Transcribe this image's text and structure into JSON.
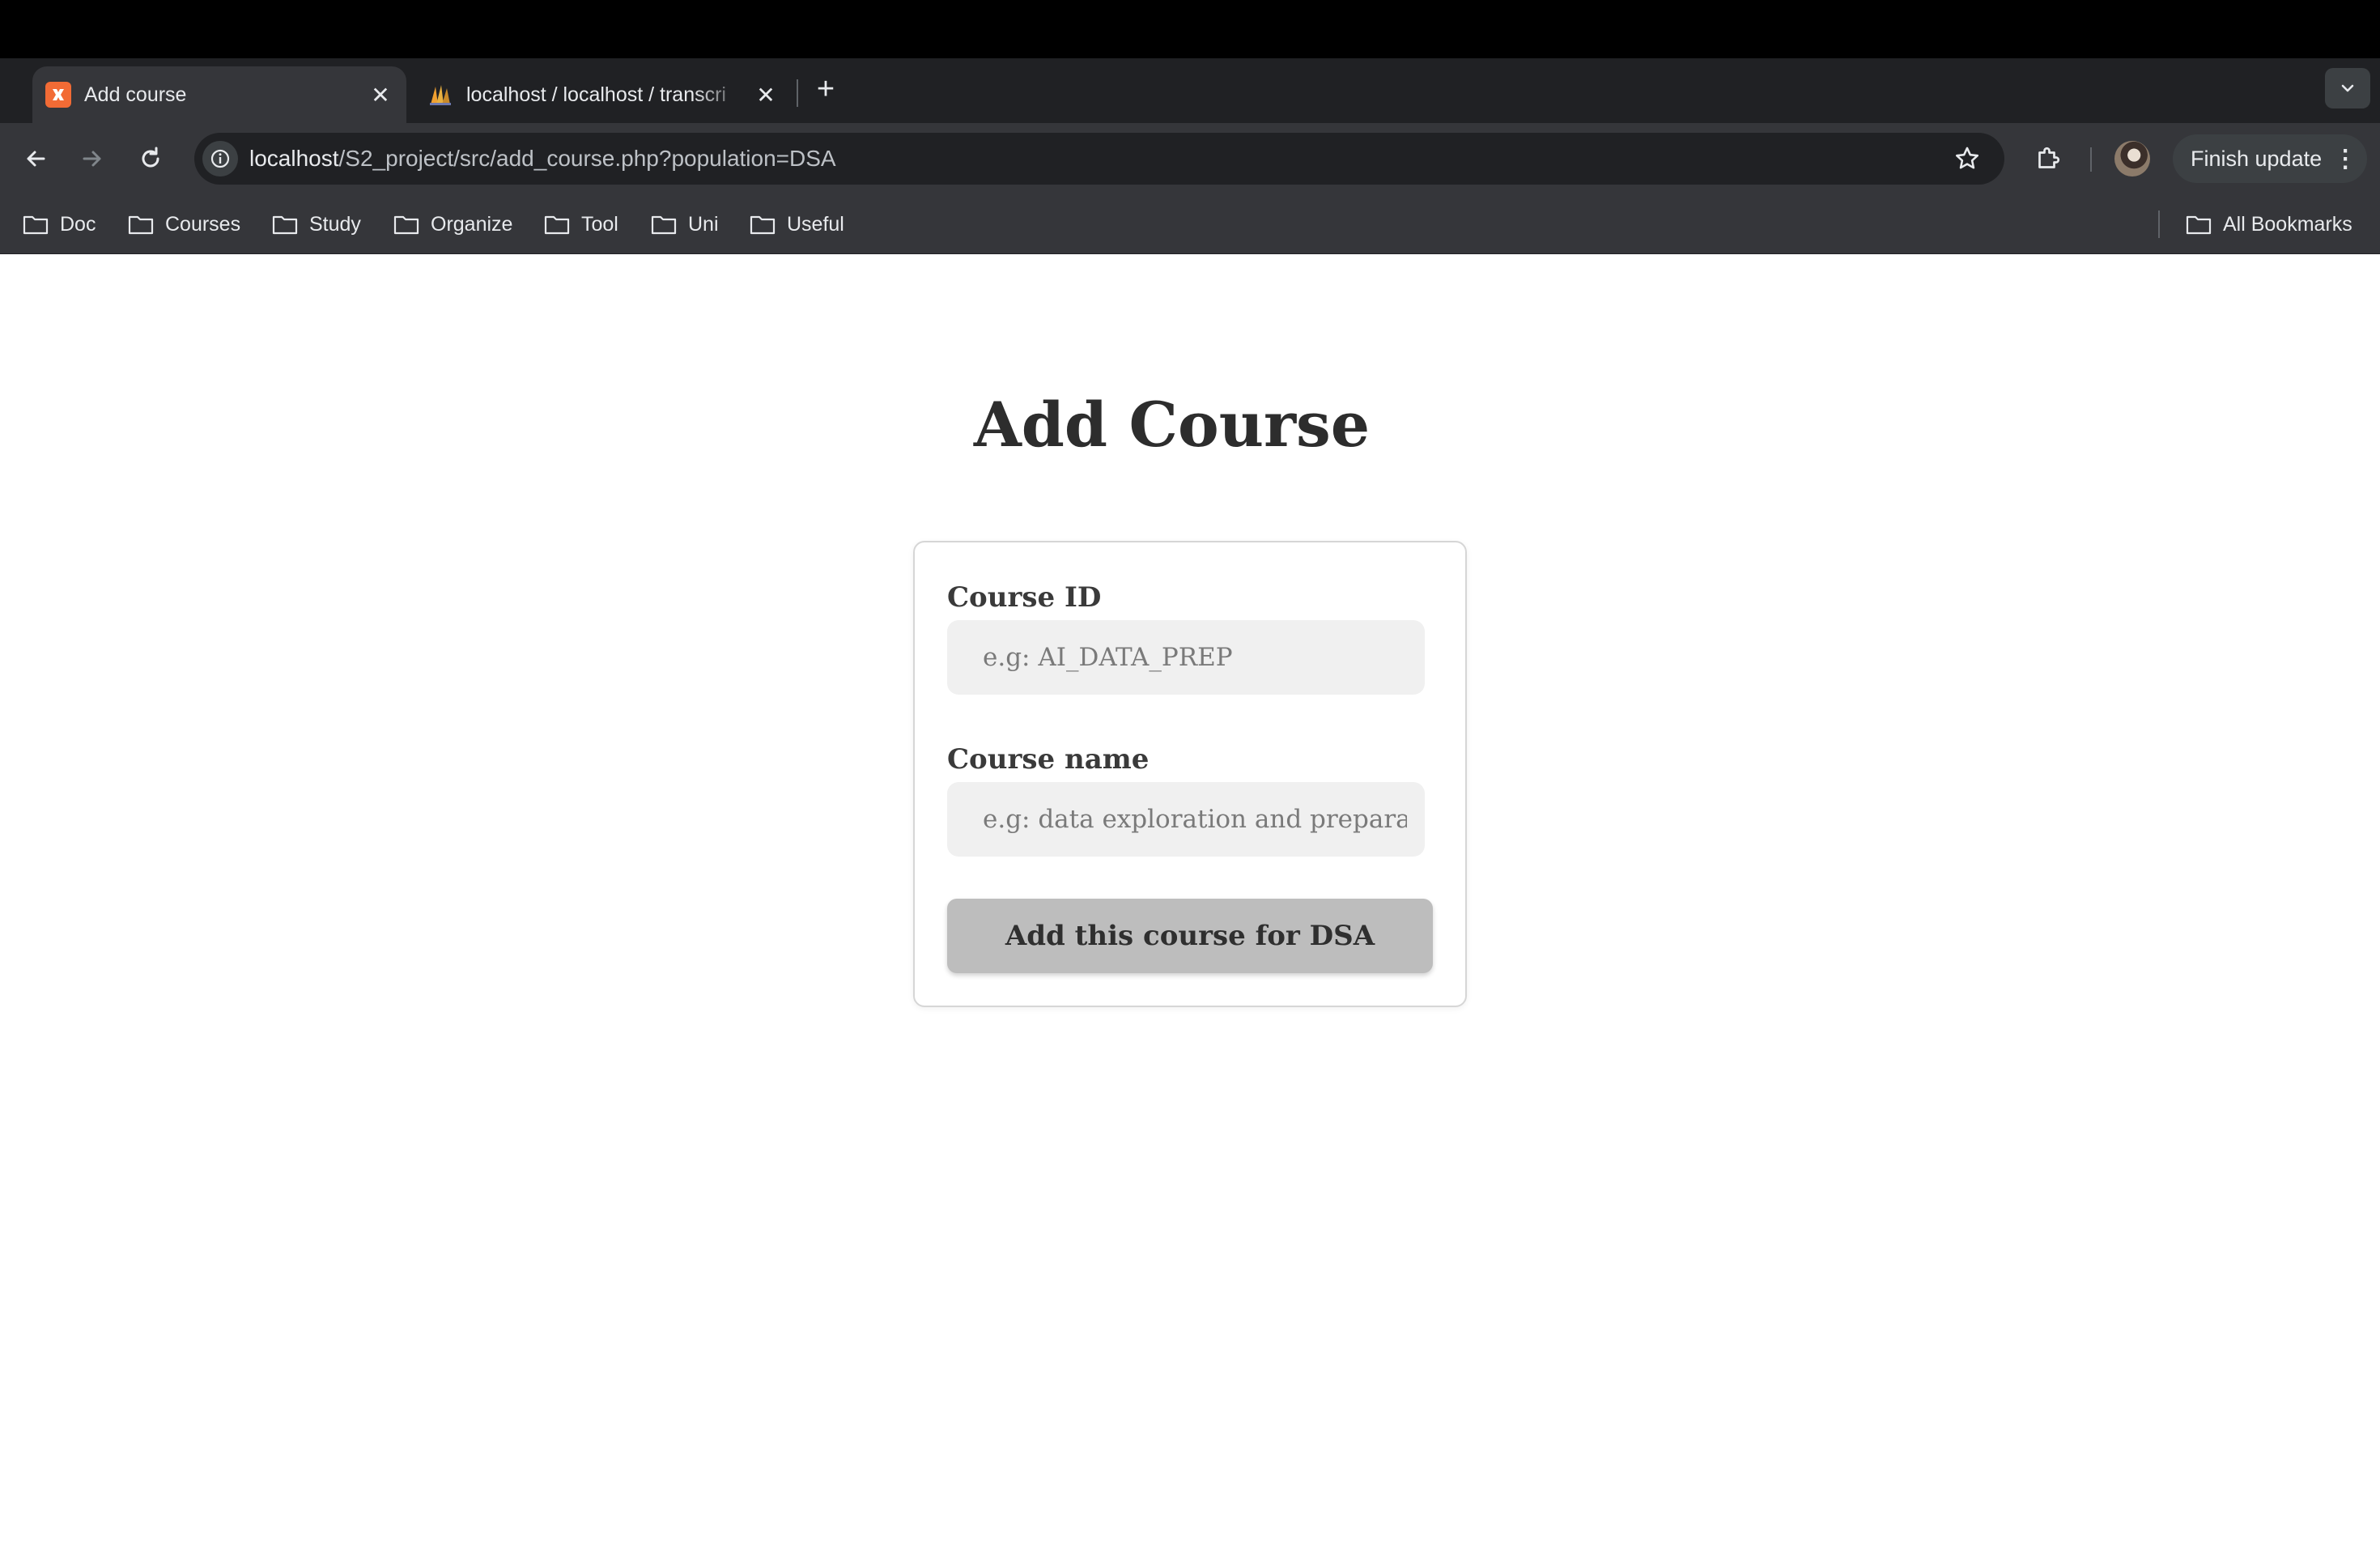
{
  "browser": {
    "tabs": [
      {
        "title": "Add course",
        "favicon": "xampp-icon",
        "active": true
      },
      {
        "title": "localhost / localhost / transcri",
        "favicon": "phpmyadmin-icon",
        "active": false
      }
    ],
    "address_bar": {
      "host": "localhost",
      "path": "/S2_project/src/add_course.php?population=DSA"
    },
    "update_button": "Finish update",
    "bookmarks": [
      "Doc",
      "Courses",
      "Study",
      "Organize",
      "Tool",
      "Uni",
      "Useful"
    ],
    "all_bookmarks": "All Bookmarks"
  },
  "page": {
    "title": "Add Course",
    "form": {
      "course_id_label": "Course ID",
      "course_id_placeholder": "e.g: AI_DATA_PREP",
      "course_id_value": "",
      "course_name_label": "Course name",
      "course_name_placeholder": "e.g: data exploration and preparation",
      "course_name_value": "",
      "submit_label": "Add this course for DSA"
    }
  },
  "colors": {
    "tab_strip": "#202124",
    "toolbar": "#35363a",
    "favicon_accent": "#f26b35",
    "button_bg": "#bdbdbd",
    "input_bg": "#f0f0f0"
  }
}
